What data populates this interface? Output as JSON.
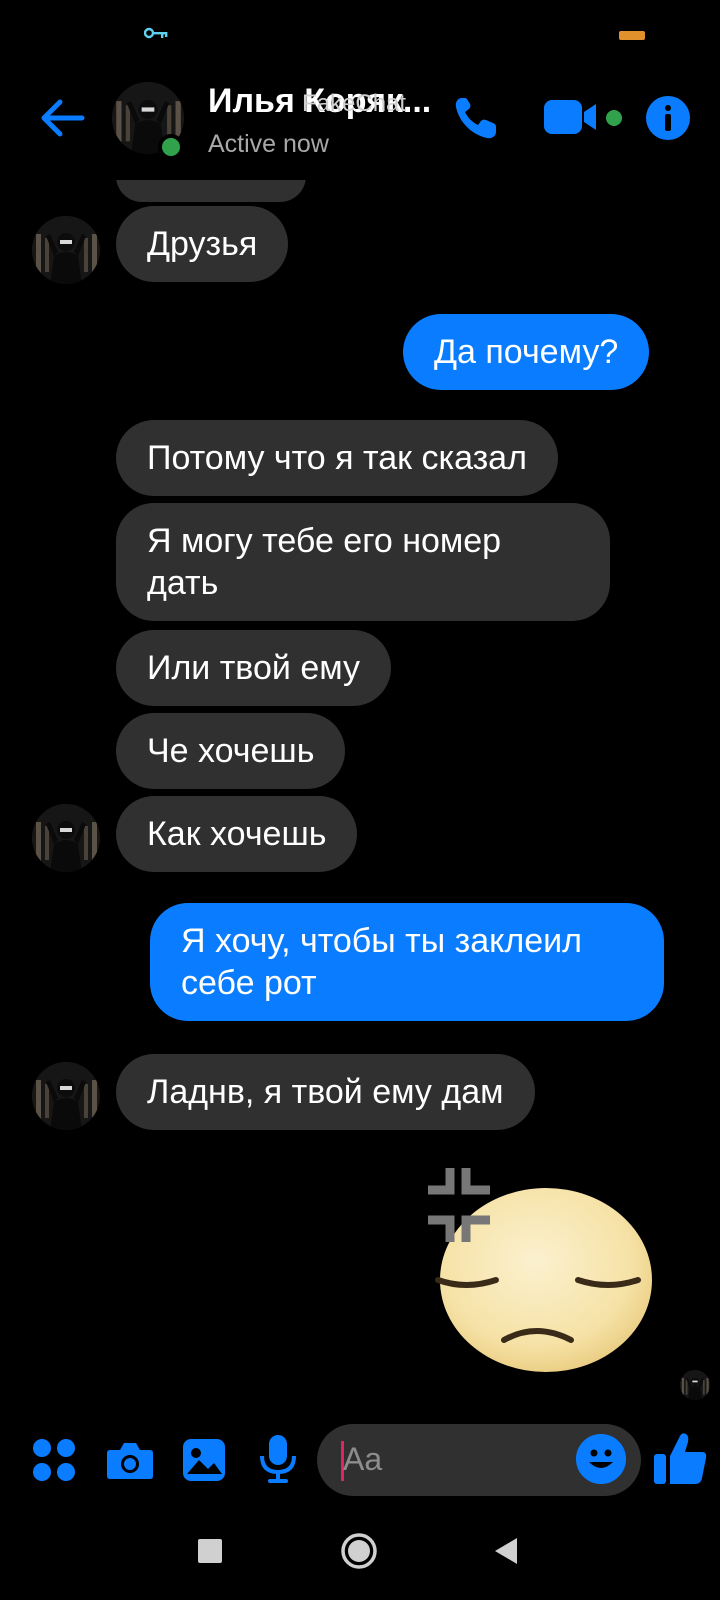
{
  "colors": {
    "accent": "#0a7cff",
    "incoming_bubble": "#303030",
    "online": "#31a24c",
    "background": "#000000"
  },
  "status_bar": {
    "left_icon": "key-icon",
    "right_icon": "battery-icon"
  },
  "header": {
    "contact_name": "Илья Коряк...",
    "status": "Active now",
    "watermark": "FakeChat",
    "icons": [
      "back-arrow-icon",
      "phone-icon",
      "video-camera-icon",
      "info-icon"
    ]
  },
  "messages": [
    {
      "from": "them",
      "text": "Друзья"
    },
    {
      "from": "me",
      "text": "Да почему?"
    },
    {
      "from": "them",
      "text": "Потому что я так сказал"
    },
    {
      "from": "them",
      "text": "Я могу тебе его номер дать"
    },
    {
      "from": "them",
      "text": "Или твой ему"
    },
    {
      "from": "them",
      "text": "Че хочешь"
    },
    {
      "from": "them",
      "text": "Как хочешь"
    },
    {
      "from": "me",
      "text": "Я хочу, чтобы ты заклеил себе рот"
    },
    {
      "from": "them",
      "text": "Ладнв, я твой ему дам"
    },
    {
      "from": "me",
      "type": "sticker",
      "sticker": "annoyed-face-sticker"
    }
  ],
  "composer": {
    "placeholder": "Aa",
    "icons": [
      "menu-dots-icon",
      "camera-icon",
      "gallery-icon",
      "microphone-icon",
      "emoji-icon",
      "thumbs-up-icon"
    ]
  },
  "nav_bar": {
    "icons": [
      "recents-square-icon",
      "home-circle-icon",
      "back-triangle-icon"
    ]
  }
}
